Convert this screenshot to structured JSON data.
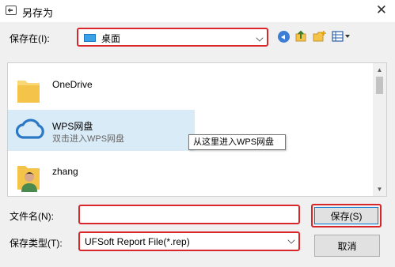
{
  "window": {
    "title": "另存为",
    "close_glyph": "✕"
  },
  "save_in": {
    "label": "保存在(I):",
    "value": "桌面"
  },
  "toolbar": {
    "back_icon": "back-arrow-icon",
    "up_icon": "up-folder-icon",
    "new_folder_icon": "new-folder-icon",
    "view_icon": "view-menu-icon"
  },
  "file_list": {
    "items": [
      {
        "name": "OneDrive",
        "subtitle": "",
        "icon": "folder-icon"
      },
      {
        "name": "WPS网盘",
        "subtitle": "双击进入WPS网盘",
        "icon": "cloud-icon"
      },
      {
        "name": "zhang",
        "subtitle": "",
        "icon": "user-folder-icon"
      }
    ],
    "tooltip": "从这里进入WPS网盘"
  },
  "filename": {
    "label": "文件名(N):",
    "value": ""
  },
  "filetype": {
    "label": "保存类型(T):",
    "value": "UFSoft Report File(*.rep)"
  },
  "buttons": {
    "save": "保存(S)",
    "cancel": "取消"
  },
  "colors": {
    "highlight_border": "#d9262b",
    "selection": "#d9ebf7",
    "accent": "#0078d7"
  }
}
